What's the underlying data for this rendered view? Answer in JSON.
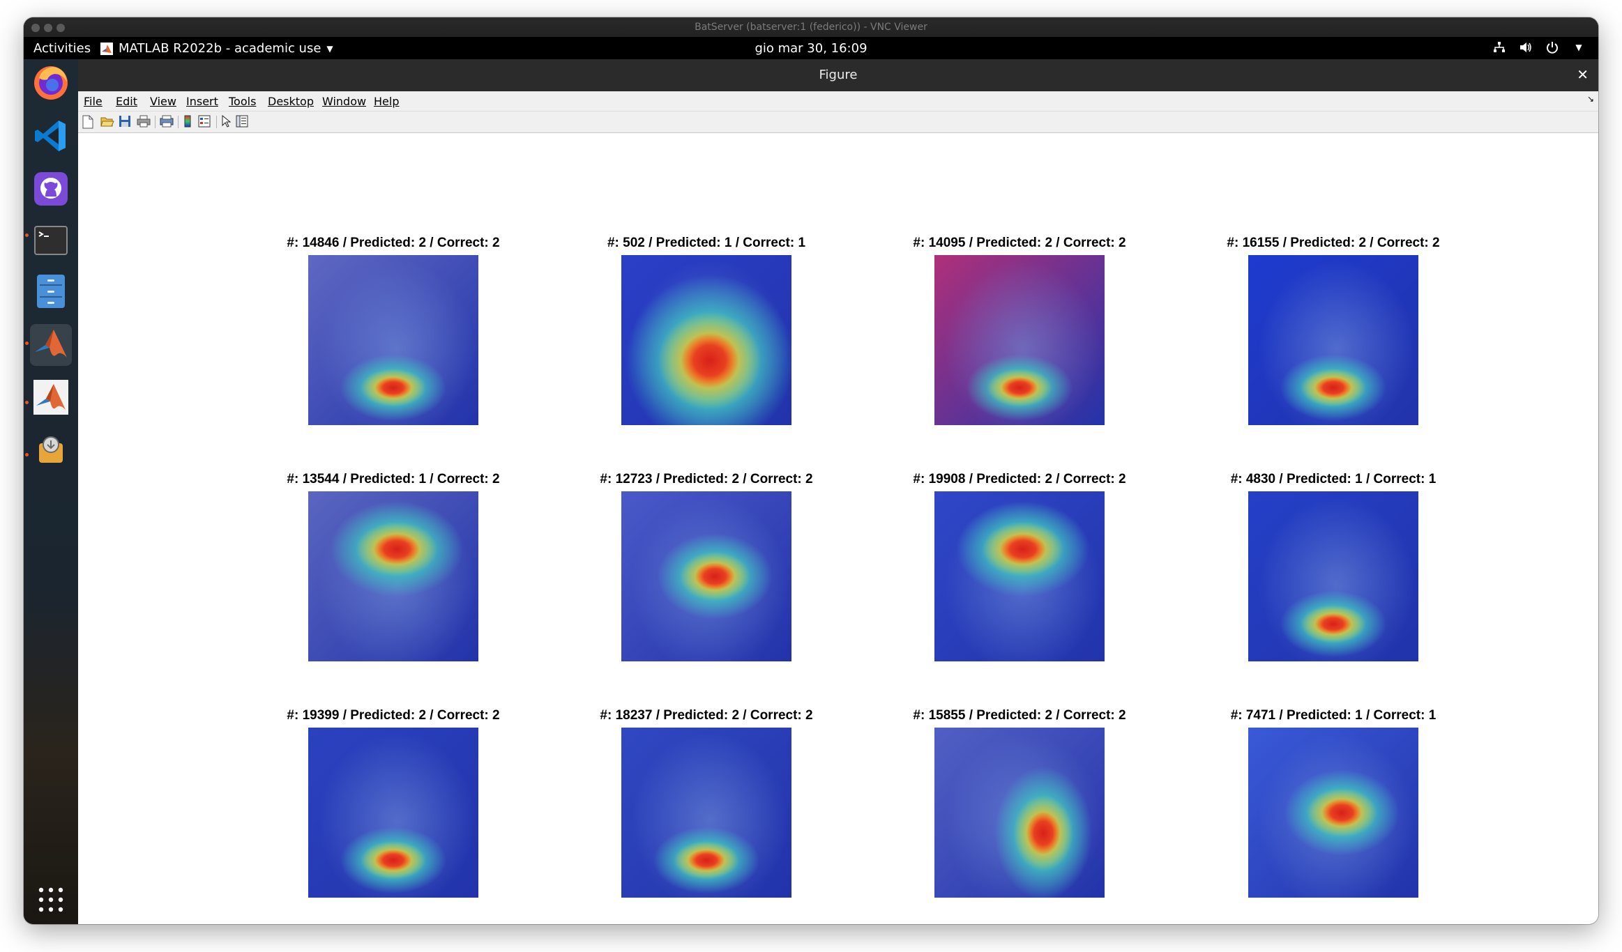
{
  "vnc": {
    "title": "BatServer (batserver:1 (federico)) - VNC Viewer"
  },
  "topbar": {
    "activities": "Activities",
    "app_name": "MATLAB R2022b - academic use",
    "clock": "gio mar 30, 16:09"
  },
  "dock": {
    "items": [
      {
        "icon": "firefox-icon",
        "running": false
      },
      {
        "icon": "vscode-icon",
        "running": false
      },
      {
        "icon": "github-desktop-icon",
        "running": false
      },
      {
        "icon": "terminal-icon",
        "running": true
      },
      {
        "icon": "files-icon",
        "running": false
      },
      {
        "icon": "matlab-icon",
        "running": true,
        "active": true
      },
      {
        "icon": "matlab-icon",
        "running": true
      },
      {
        "icon": "software-updater-icon",
        "running": true
      }
    ],
    "apps_grid_icon": "apps-grid-icon"
  },
  "figure": {
    "title": "Figure",
    "menu": [
      "File",
      "Edit",
      "View",
      "Insert",
      "Tools",
      "Desktop",
      "Window",
      "Help"
    ],
    "toolbar": [
      "new-figure-icon",
      "open-file-icon",
      "save-icon",
      "print-icon",
      "print-preview-icon",
      "colorbar-icon",
      "legend-icon",
      "pointer-icon",
      "property-editor-icon"
    ]
  },
  "subplots": [
    {
      "title": "#: 14846 / Predicted: 2 / Correct: 2",
      "bg": "#5f68c2",
      "hot": "mouth"
    },
    {
      "title": "#: 502 / Predicted: 1 / Correct: 1",
      "bg": "#2a3fc8",
      "hot": "face"
    },
    {
      "title": "#: 14095 / Predicted: 2 / Correct: 2",
      "bg": "#b0307a",
      "hot": "mouth"
    },
    {
      "title": "#: 16155 / Predicted: 2 / Correct: 2",
      "bg": "#1e3bd0",
      "hot": "mouth"
    },
    {
      "title": "#: 13544 / Predicted: 1 / Correct: 2",
      "bg": "#5b66c0",
      "hot": "forehead"
    },
    {
      "title": "#: 12723 / Predicted: 2 / Correct: 2",
      "bg": "#4a5ac8",
      "hot": "eyes"
    },
    {
      "title": "#: 19908 / Predicted: 2 / Correct: 2",
      "bg": "#2f47c8",
      "hot": "forehead"
    },
    {
      "title": "#: 4830 / Predicted: 1 / Correct: 1",
      "bg": "#2440c8",
      "hot": "mouth"
    },
    {
      "title": "#: 19399 / Predicted: 2 / Correct: 2",
      "bg": "#2b42c0",
      "hot": "mouth"
    },
    {
      "title": "#: 18237 / Predicted: 2 / Correct: 2",
      "bg": "#3048c2",
      "hot": "mouth"
    },
    {
      "title": "#: 15855 / Predicted: 2 / Correct: 2",
      "bg": "#5260c4",
      "hot": "cheek"
    },
    {
      "title": "#: 7471 / Predicted: 1 / Correct: 1",
      "bg": "#3a5ad8",
      "hot": "eyes"
    }
  ]
}
